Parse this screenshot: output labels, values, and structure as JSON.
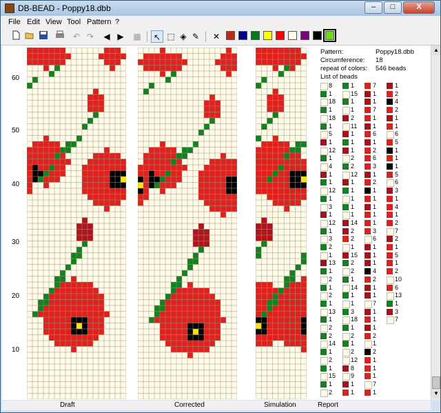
{
  "window": {
    "title": "DB-BEAD - Poppy18.dbb",
    "controls": {
      "minimize": "–",
      "maximize": "□",
      "close": "X"
    }
  },
  "menu": [
    "File",
    "Edit",
    "View",
    "Tool",
    "Pattern",
    "?"
  ],
  "toolbar": {
    "icons": [
      "new-file-icon",
      "open-folder-icon",
      "save-icon",
      "print-icon",
      "undo-icon",
      "redo-icon",
      "arrow-left-icon",
      "arrow-right-icon",
      "preview-icon",
      "pointer-icon",
      "select-rect-icon",
      "fill-icon",
      "eyedropper-icon",
      "clear-x-icon"
    ],
    "colors": [
      "#c0281c",
      "#00008b",
      "#007a1a",
      "#ffff00",
      "#ff0000",
      "#fffbe6",
      "#800080",
      "#000000",
      "#6fdc10"
    ]
  },
  "ruler": [
    "60",
    "50",
    "40",
    "30",
    "20",
    "10"
  ],
  "views": [
    "Draft",
    "Corrected",
    "Simulation",
    "Report"
  ],
  "report": {
    "pattern_label": "Pattern:",
    "pattern_value": "Poppy18.dbb",
    "circ_label": "Circumference:",
    "circ_value": "18",
    "repeat_label": "repeat of colors:",
    "repeat_value": "546 beads",
    "list_label": "List of beads"
  },
  "bead_list": [
    [
      [
        "y",
        "8"
      ],
      [
        "g",
        "1"
      ],
      [
        "r",
        "7"
      ],
      [
        "dr",
        "1"
      ]
    ],
    [
      [
        "g",
        "1"
      ],
      [
        "y",
        "15"
      ],
      [
        "dr",
        "1"
      ],
      [
        "r",
        "2"
      ]
    ],
    [
      [
        "y",
        "18"
      ],
      [
        "g",
        "1"
      ],
      [
        "dr",
        "1"
      ],
      [
        "k",
        "4"
      ]
    ],
    [
      [
        "g",
        "1"
      ],
      [
        "y",
        "1"
      ],
      [
        "r",
        "7"
      ],
      [
        "r",
        "2"
      ]
    ],
    [
      [
        "y",
        "18"
      ],
      [
        "dr",
        "2"
      ],
      [
        "r",
        "1"
      ],
      [
        "dr",
        "1"
      ]
    ],
    [
      [
        "g",
        "1"
      ],
      [
        "y",
        "11"
      ],
      [
        "dr",
        "1"
      ],
      [
        "r",
        "1"
      ]
    ],
    [
      [
        "y",
        "5"
      ],
      [
        "dr",
        "1"
      ],
      [
        "r",
        "6"
      ],
      [
        "y",
        "6"
      ]
    ],
    [
      [
        "dr",
        "1"
      ],
      [
        "g",
        "1"
      ],
      [
        "dr",
        "1"
      ],
      [
        "r",
        "5"
      ]
    ],
    [
      [
        "y",
        "12"
      ],
      [
        "dr",
        "1"
      ],
      [
        "r",
        "2"
      ],
      [
        "k",
        "1"
      ]
    ],
    [
      [
        "g",
        "1"
      ],
      [
        "y",
        "2"
      ],
      [
        "r",
        "6"
      ],
      [
        "r",
        "1"
      ]
    ],
    [
      [
        "y",
        "4"
      ],
      [
        "g",
        "2"
      ],
      [
        "r",
        "3"
      ],
      [
        "k",
        "1"
      ]
    ],
    [
      [
        "dr",
        "1"
      ],
      [
        "y",
        "12"
      ],
      [
        "dr",
        "1"
      ],
      [
        "r",
        "5"
      ]
    ],
    [
      [
        "g",
        "1"
      ],
      [
        "dr",
        "1"
      ],
      [
        "r",
        "2"
      ],
      [
        "y",
        "6"
      ]
    ],
    [
      [
        "y",
        "12"
      ],
      [
        "g",
        "1"
      ],
      [
        "k",
        "1"
      ],
      [
        "dr",
        "3"
      ]
    ],
    [
      [
        "g",
        "1"
      ],
      [
        "y",
        "1"
      ],
      [
        "r",
        "1"
      ],
      [
        "r",
        "1"
      ]
    ],
    [
      [
        "y",
        "3"
      ],
      [
        "g",
        "1"
      ],
      [
        "dr",
        "1"
      ],
      [
        "r",
        "4"
      ]
    ],
    [
      [
        "dr",
        "1"
      ],
      [
        "y",
        "1"
      ],
      [
        "r",
        "1"
      ],
      [
        "r",
        "1"
      ]
    ],
    [
      [
        "y",
        "12"
      ],
      [
        "dr",
        "14"
      ],
      [
        "r",
        "1"
      ],
      [
        "r",
        "2"
      ]
    ],
    [
      [
        "g",
        "1"
      ],
      [
        "dr",
        "2"
      ],
      [
        "r",
        "3"
      ],
      [
        "y",
        "7"
      ]
    ],
    [
      [
        "y",
        "3"
      ],
      [
        "r",
        "2"
      ],
      [
        "y",
        "6"
      ],
      [
        "dr",
        "2"
      ]
    ],
    [
      [
        "g",
        "2"
      ],
      [
        "y",
        "1"
      ],
      [
        "dr",
        "1"
      ],
      [
        "r",
        "1"
      ]
    ],
    [
      [
        "y",
        "1"
      ],
      [
        "dr",
        "15"
      ],
      [
        "dr",
        "1"
      ],
      [
        "r",
        "5"
      ]
    ],
    [
      [
        "dr",
        "13"
      ],
      [
        "g",
        "2"
      ],
      [
        "dr",
        "1"
      ],
      [
        "r",
        "1"
      ]
    ],
    [
      [
        "g",
        "1"
      ],
      [
        "y",
        "2"
      ],
      [
        "k",
        "4"
      ],
      [
        "r",
        "2"
      ]
    ],
    [
      [
        "y",
        "2"
      ],
      [
        "g",
        "1"
      ],
      [
        "r",
        "2"
      ],
      [
        "y",
        "10"
      ]
    ],
    [
      [
        "g",
        "1"
      ],
      [
        "y",
        "14"
      ],
      [
        "dr",
        "1"
      ],
      [
        "r",
        "6"
      ]
    ],
    [
      [
        "y",
        "2"
      ],
      [
        "g",
        "1"
      ],
      [
        "dr",
        "1"
      ],
      [
        "y",
        "13"
      ]
    ],
    [
      [
        "g",
        "1"
      ],
      [
        "y",
        "1"
      ],
      [
        "y",
        "7"
      ],
      [
        "g",
        "1"
      ]
    ],
    [
      [
        "y",
        "13"
      ],
      [
        "g",
        "3"
      ],
      [
        "dr",
        "1"
      ],
      [
        "dr",
        "3"
      ]
    ],
    [
      [
        "g",
        "1"
      ],
      [
        "y",
        "18"
      ],
      [
        "r",
        "1"
      ],
      [
        "y",
        "7"
      ]
    ],
    [
      [
        "y",
        "2"
      ],
      [
        "g",
        "1"
      ],
      [
        "dr",
        "1"
      ],
      [
        "",
        ""
      ]
    ],
    [
      [
        "g",
        "2"
      ],
      [
        "y",
        "2"
      ],
      [
        "r",
        "2"
      ],
      [
        "",
        ""
      ]
    ],
    [
      [
        "y",
        "14"
      ],
      [
        "g",
        "1"
      ],
      [
        "y",
        "1"
      ],
      [
        "",
        ""
      ]
    ],
    [
      [
        "g",
        "1"
      ],
      [
        "y",
        "2"
      ],
      [
        "k",
        "2"
      ],
      [
        "",
        ""
      ]
    ],
    [
      [
        "y",
        "2"
      ],
      [
        "y",
        "12"
      ],
      [
        "r",
        "1"
      ],
      [
        "",
        ""
      ]
    ],
    [
      [
        "g",
        "1"
      ],
      [
        "dr",
        "8"
      ],
      [
        "r",
        "1"
      ],
      [
        "",
        ""
      ]
    ],
    [
      [
        "y",
        "15"
      ],
      [
        "y",
        "9"
      ],
      [
        "r",
        "1"
      ],
      [
        "",
        ""
      ]
    ],
    [
      [
        "g",
        "1"
      ],
      [
        "dr",
        "1"
      ],
      [
        "y",
        "7"
      ],
      [
        "",
        ""
      ]
    ],
    [
      [
        "y",
        "2"
      ],
      [
        "r",
        "1"
      ],
      [
        "r",
        "1"
      ],
      [
        "",
        ""
      ]
    ]
  ]
}
